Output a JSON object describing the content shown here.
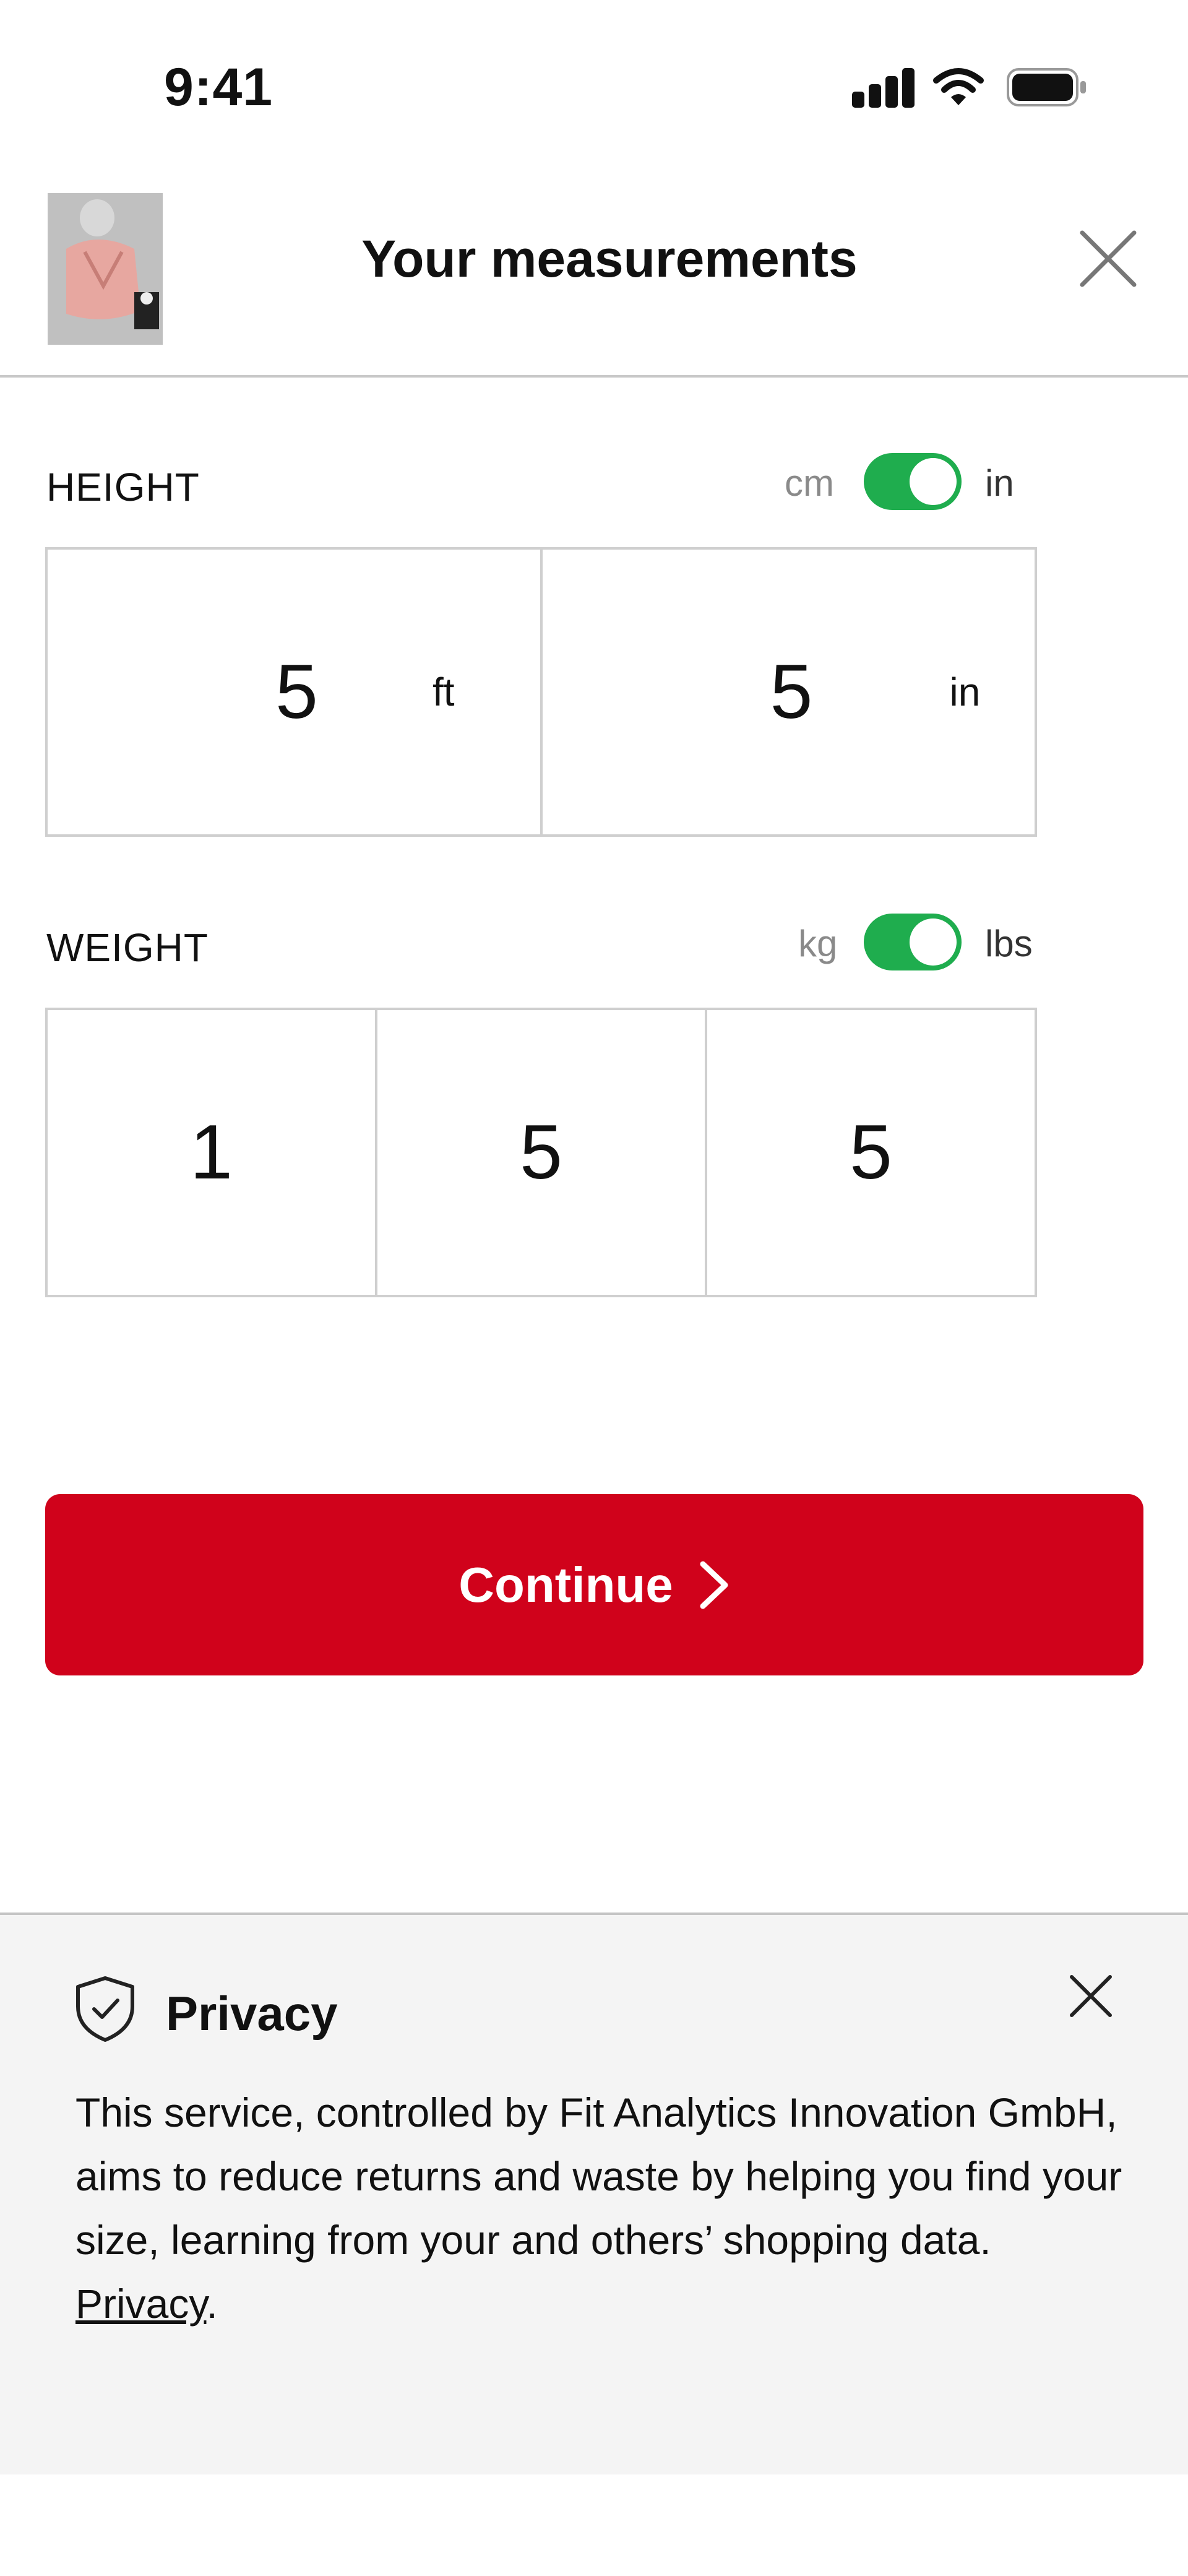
{
  "status_bar": {
    "time": "9:41"
  },
  "header": {
    "title": "Your measurements"
  },
  "height": {
    "label": "HEIGHT",
    "unit_left": "cm",
    "unit_right": "in",
    "feet_value": "5",
    "feet_unit": "ft",
    "inches_value": "5",
    "inches_unit": "in"
  },
  "weight": {
    "label": "WEIGHT",
    "unit_left": "kg",
    "unit_right": "lbs",
    "digits": [
      "1",
      "5",
      "5"
    ]
  },
  "continue_button": {
    "label": "Continue"
  },
  "privacy": {
    "title": "Privacy",
    "text": "This service, controlled by Fit Analytics Innovation GmbH, aims to reduce returns and waste by helping you find your size, learning from your and others’ shopping data.",
    "link_label": "Privacy",
    "trailing": "."
  },
  "colors": {
    "accent_red": "#d0021b",
    "toggle_green": "#1fad4e"
  }
}
